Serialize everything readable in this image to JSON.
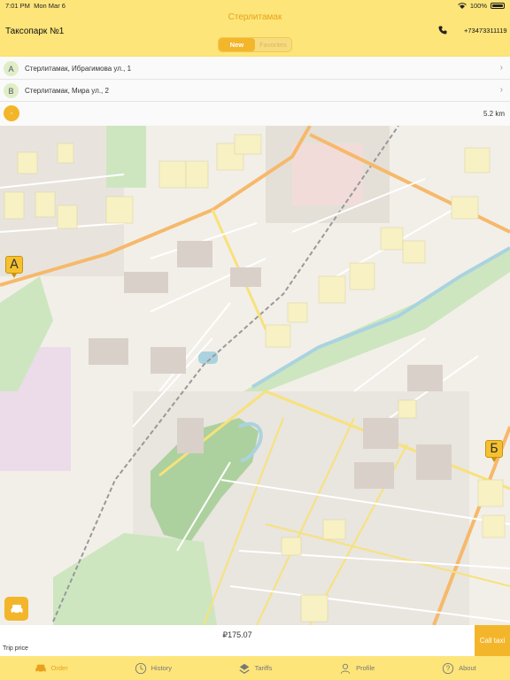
{
  "status": {
    "time": "7:01 PM",
    "date": "Mon Mar 6",
    "battery": "100%"
  },
  "header": {
    "city": "Стерлитамак",
    "park": "Таксопарк №1",
    "phone": "+73473311119",
    "tabs": {
      "new": "New",
      "favorites": "Favorites"
    }
  },
  "addresses": [
    {
      "marker": "A",
      "text": "Стерлитамак, Ибрагимова ул., 1"
    },
    {
      "marker": "B",
      "text": "Стерлитамак, Мира ул., 2"
    }
  ],
  "route": {
    "distance": "5.2 km",
    "button_icon": "route-icon"
  },
  "map": {
    "start_marker": "А",
    "end_marker": "Б",
    "road_color": "#f6b96b",
    "park_color": "#cde6c0",
    "river_color": "#aad3df"
  },
  "price": {
    "value": "₽175.07",
    "label": "Trip price",
    "call_label": "Call taxi"
  },
  "nav": [
    {
      "label": "Order",
      "icon": "car-icon",
      "active": true
    },
    {
      "label": "History",
      "icon": "clock-icon",
      "active": false
    },
    {
      "label": "Tariffs",
      "icon": "tariffs-icon",
      "active": false
    },
    {
      "label": "Profile",
      "icon": "profile-icon",
      "active": false
    },
    {
      "label": "About",
      "icon": "question-icon",
      "active": false
    }
  ],
  "colors": {
    "accent": "#f3b62b",
    "header_bg": "#fde57a",
    "city_text": "#e9a11a"
  }
}
